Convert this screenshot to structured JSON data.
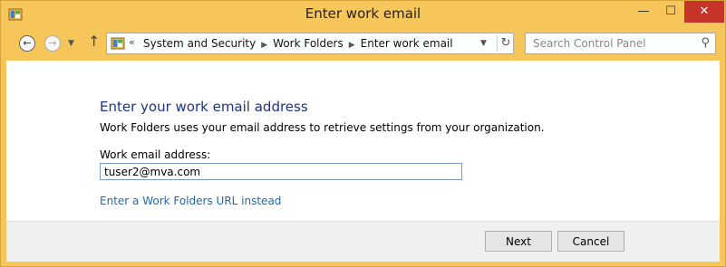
{
  "window": {
    "title": "Enter work email",
    "minimize_glyph": "—",
    "maximize_glyph": "☐",
    "close_glyph": "✕",
    "app_icon": "control-panel-icon"
  },
  "toolbar": {
    "back_glyph": "←",
    "forward_glyph": "→",
    "recent_glyph": "▼",
    "up_glyph": "↑",
    "breadcrumb_overflow": "«",
    "breadcrumbs": [
      "System and Security",
      "Work Folders",
      "Enter work email"
    ],
    "breadcrumb_separator": "▶",
    "address_dropdown_glyph": "▼",
    "refresh_glyph": "↻",
    "search_placeholder": "Search Control Panel",
    "search_glyph": "⚲"
  },
  "main": {
    "heading": "Enter your work email address",
    "description": "Work Folders uses your email address to retrieve settings from your organization.",
    "email_label": "Work email address:",
    "email_value": "tuser2@mva.com",
    "url_link": "Enter a Work Folders URL instead"
  },
  "footer": {
    "next_label": "Next",
    "cancel_label": "Cancel"
  },
  "colors": {
    "frame": "#f6c65a",
    "heading": "#1e3287",
    "link": "#1a69b8",
    "close_button": "#c7352a"
  }
}
